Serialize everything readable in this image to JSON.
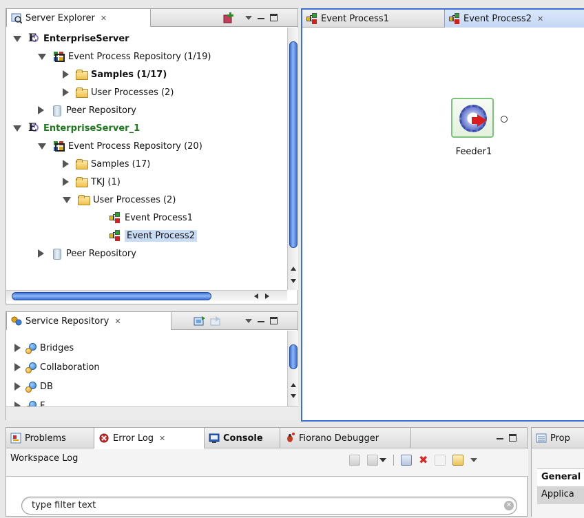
{
  "server_explorer": {
    "title": "Server Explorer",
    "tree": [
      {
        "label": "EnterpriseServer",
        "level": 0,
        "state": "open",
        "icon": "server-icon",
        "bold": true
      },
      {
        "label": "Event Process Repository (1/19)",
        "level": 1,
        "state": "open",
        "icon": "repository-icon"
      },
      {
        "label": "Samples (1/17)",
        "level": 2,
        "state": "closed",
        "icon": "folder-icon",
        "bold": true
      },
      {
        "label": "User Processes (2)",
        "level": 2,
        "state": "closed",
        "icon": "folder-icon"
      },
      {
        "label": "Peer Repository",
        "level": 1,
        "state": "closed",
        "icon": "peer-repository-icon"
      },
      {
        "label": "EnterpriseServer_1",
        "level": 0,
        "state": "open",
        "icon": "server-icon",
        "bold": true,
        "color": "#1c7a1c"
      },
      {
        "label": "Event Process Repository (20)",
        "level": 1,
        "state": "open",
        "icon": "repository-icon"
      },
      {
        "label": "Samples (17)",
        "level": 2,
        "state": "closed",
        "icon": "folder-icon"
      },
      {
        "label": "TKJ (1)",
        "level": 2,
        "state": "closed",
        "icon": "folder-icon"
      },
      {
        "label": "User Processes (2)",
        "level": 2,
        "state": "open",
        "icon": "folder-icon"
      },
      {
        "label": "Event Process1",
        "level": 3,
        "state": "leaf",
        "icon": "event-process-icon"
      },
      {
        "label": "Event Process2",
        "level": 3,
        "state": "leaf",
        "icon": "event-process-icon",
        "selected": true
      },
      {
        "label": "Peer Repository",
        "level": 1,
        "state": "closed",
        "icon": "peer-repository-icon"
      }
    ]
  },
  "service_repository": {
    "title": "Service Repository",
    "items": [
      "Bridges",
      "Collaboration",
      "DB",
      "F"
    ]
  },
  "editor": {
    "tabs": [
      {
        "label": "Event Process1",
        "active": false
      },
      {
        "label": "Event Process2",
        "active": true
      }
    ],
    "node": {
      "label": "Feeder1"
    }
  },
  "bottom": {
    "tabs": [
      {
        "label": "Problems"
      },
      {
        "label": "Error Log",
        "active": true
      },
      {
        "label": "Console"
      },
      {
        "label": "Fiorano Debugger"
      }
    ],
    "workspace_log_label": "Workspace Log",
    "filter_placeholder": "type filter text"
  },
  "properties": {
    "tab_label": "Prop",
    "rows": [
      "General",
      "Applica"
    ]
  },
  "colors": {
    "selection": "#c8dcf5",
    "server_green": "#1c7a1c",
    "canvas_border": "#3b6fd6"
  }
}
